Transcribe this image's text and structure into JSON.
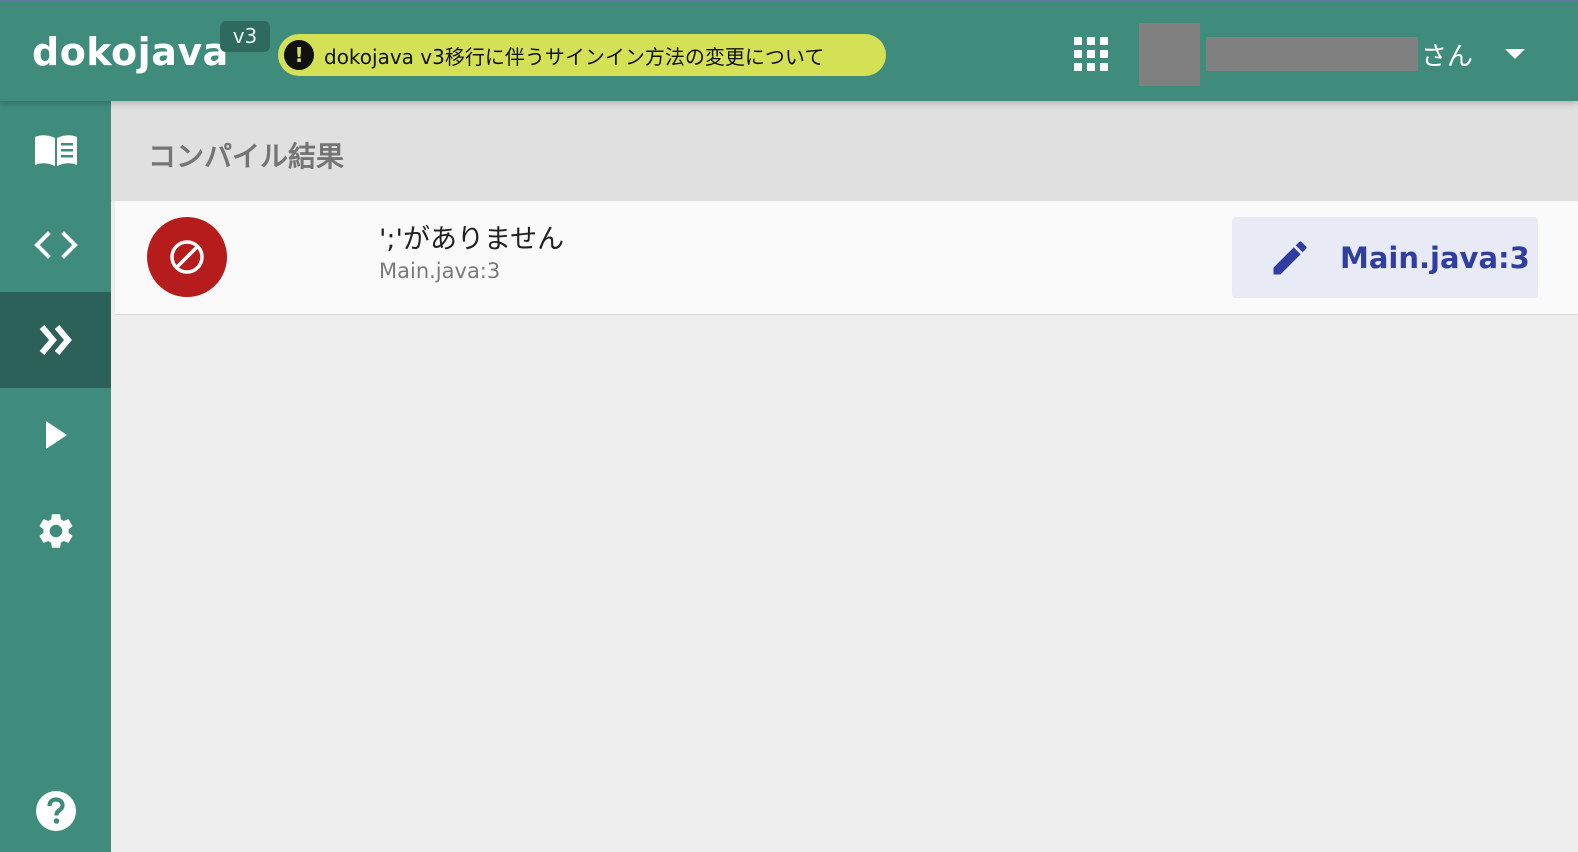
{
  "header": {
    "logo": "dokojava",
    "version": "v3",
    "notice_icon": "!",
    "notice_text": "dokojava v3移行に伴うサインイン方法の変更について",
    "user_suffix": "さん"
  },
  "sidebar": {
    "items": [
      {
        "icon": "book-icon"
      },
      {
        "icon": "code-icon"
      },
      {
        "icon": "double-chevron-right-icon",
        "active": true
      },
      {
        "icon": "play-icon"
      },
      {
        "icon": "gear-icon"
      },
      {
        "icon": "help-icon"
      }
    ]
  },
  "content": {
    "title": "コンパイル結果",
    "results": [
      {
        "message": "';'がありません",
        "location": "Main.java:3",
        "button_label": "Main.java:3"
      }
    ]
  },
  "colors": {
    "primary": "#3f8c7d",
    "sidebar_active": "#2b6158",
    "notice": "#d4e157",
    "error": "#b71c1c",
    "link": "#303f9f"
  }
}
